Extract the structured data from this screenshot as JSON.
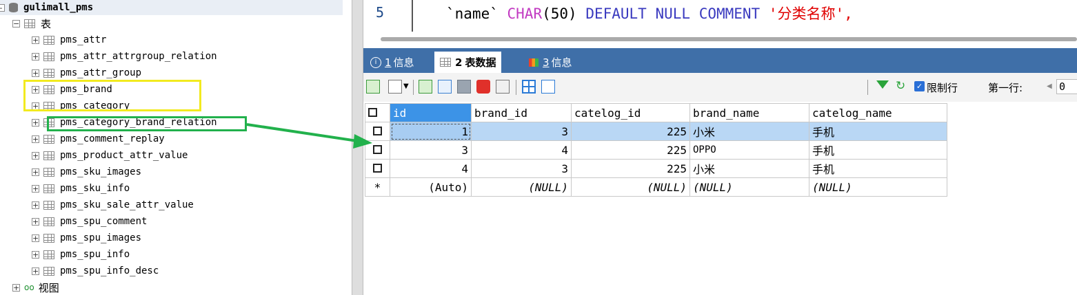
{
  "tree": {
    "database": "gulimall_pms",
    "tables_folder": "表",
    "views_folder": "视图",
    "tables": [
      "pms_attr",
      "pms_attr_attrgroup_relation",
      "pms_attr_group",
      "pms_brand",
      "pms_category",
      "pms_category_brand_relation",
      "pms_comment_replay",
      "pms_product_attr_value",
      "pms_sku_images",
      "pms_sku_info",
      "pms_sku_sale_attr_value",
      "pms_spu_comment",
      "pms_spu_images",
      "pms_spu_info",
      "pms_spu_info_desc"
    ]
  },
  "editor": {
    "line_number": "5",
    "code_name": "`name`",
    "code_type": "CHAR",
    "code_args": "(50)",
    "code_default": "DEFAULT NULL COMMENT",
    "code_comment": "'分类名称',"
  },
  "result_tabs": {
    "tab1_num": "1",
    "tab1_label": "信息",
    "tab2_num": "2",
    "tab2_label": "表数据",
    "tab3_num": "3",
    "tab3_label": "信息"
  },
  "toolbar": {
    "limit_label": "限制行",
    "first_row_label": "第一行:",
    "first_row_value": "0"
  },
  "grid": {
    "columns": [
      "id",
      "brand_id",
      "catelog_id",
      "brand_name",
      "catelog_name"
    ],
    "rows": [
      {
        "id": "1",
        "brand_id": "3",
        "catelog_id": "225",
        "brand_name": "小米",
        "catelog_name": "手机"
      },
      {
        "id": "3",
        "brand_id": "4",
        "catelog_id": "225",
        "brand_name": "OPPO",
        "catelog_name": "手机"
      },
      {
        "id": "4",
        "brand_id": "3",
        "catelog_id": "225",
        "brand_name": "小米",
        "catelog_name": "手机"
      }
    ],
    "new_row": {
      "marker": "*",
      "id": "(Auto)",
      "brand_id": "(NULL)",
      "catelog_id": "(NULL)",
      "brand_name": "(NULL)",
      "catelog_name": "(NULL)"
    }
  },
  "annotations": {
    "yellow_box_color": "#f2ea1f",
    "green_box_color": "#22b14c",
    "arrow_color": "#22b14c"
  }
}
